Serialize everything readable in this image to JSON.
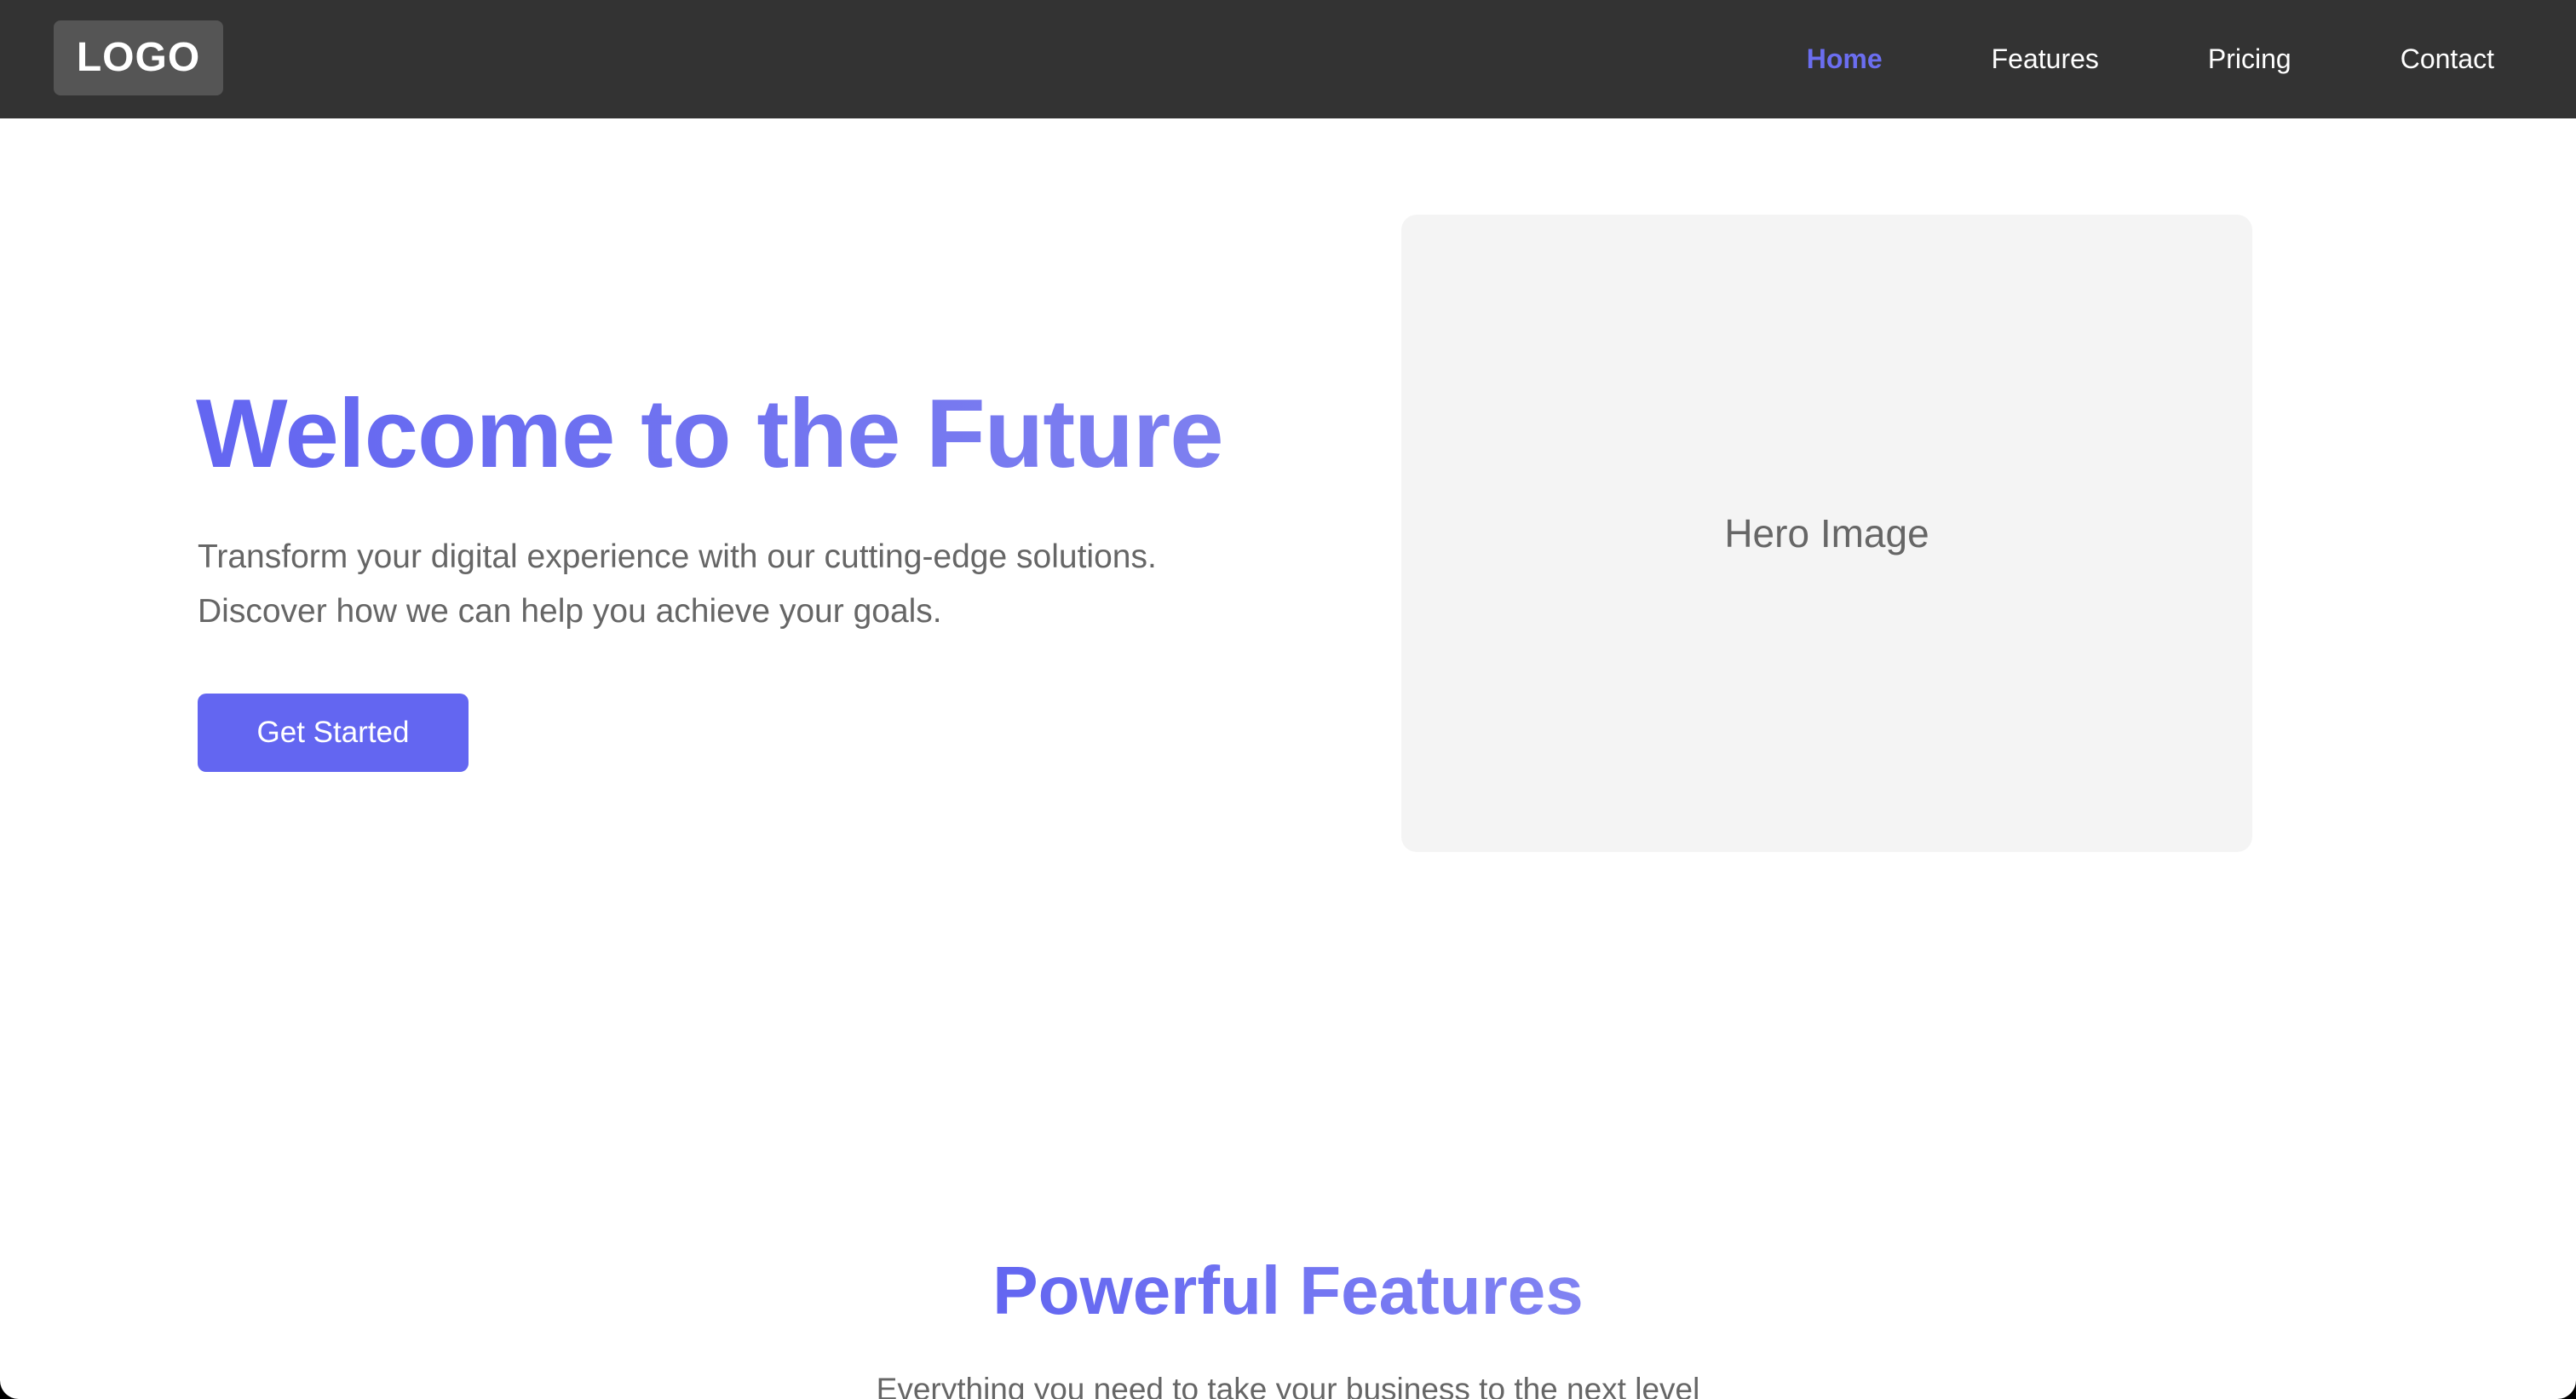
{
  "colors": {
    "nav_background": "#333333",
    "logo_background": "#555555",
    "accent": "#6366f1",
    "text_muted": "#666666",
    "placeholder_background": "#f4f4f4"
  },
  "header": {
    "logo_text": "LOGO",
    "nav": [
      {
        "label": "Home",
        "active": true
      },
      {
        "label": "Features",
        "active": false
      },
      {
        "label": "Pricing",
        "active": false
      },
      {
        "label": "Contact",
        "active": false
      }
    ]
  },
  "hero": {
    "title": "Welcome to the Future",
    "subtitle": "Transform your digital experience with our cutting-edge solutions. Discover how we can help you achieve your goals.",
    "cta_label": "Get Started",
    "image_label": "Hero Image"
  },
  "features": {
    "title": "Powerful Features",
    "subtitle": "Everything you need to take your business to the next level"
  }
}
